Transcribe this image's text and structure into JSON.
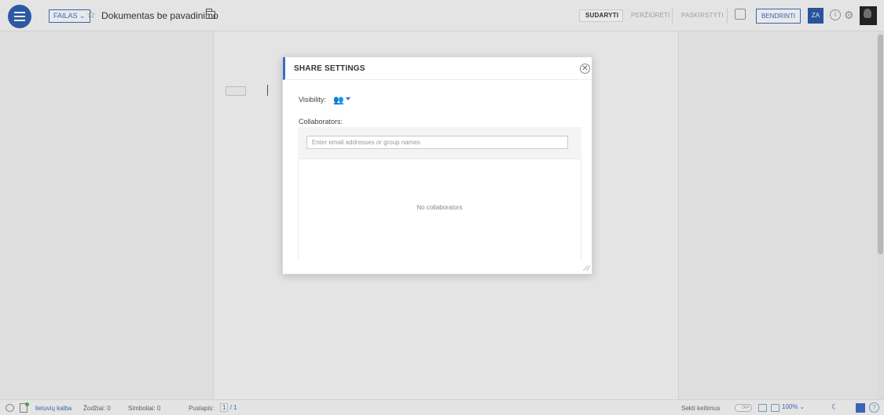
{
  "header": {
    "file_menu": "FAILAS ⌄",
    "doc_title": "Dokumentas be pavadinimo",
    "modes": [
      "SUDARYTI",
      "PERŽIŪRĖTI",
      "PASKIRSTYTI"
    ],
    "share_label": "BENDRINTI",
    "avatar_initials": "ZA",
    "info_label": "i"
  },
  "dialog": {
    "title": "SHARE SETTINGS",
    "close_label": "✕",
    "visibility_label": "Visibility:",
    "visibility_icon": "group-icon",
    "collaborators_label": "Collaborators:",
    "search_placeholder": "Enter email addresses or group names",
    "search_value": "",
    "empty_message": "No collaborators"
  },
  "footer": {
    "language": "lietuvių kalba",
    "words": "Žodžiai: 0",
    "chars": "Simboliai: 0",
    "page_label": "Puslapis:",
    "page_current": "1",
    "page_total": "1",
    "track_changes": "Sekti keitimus",
    "toggle_state": "OFF",
    "zoom": "100% ⌄",
    "help_label": "?"
  },
  "colors": {
    "accent": "#3b6cc4",
    "menu_button": "#2d5fb3"
  }
}
